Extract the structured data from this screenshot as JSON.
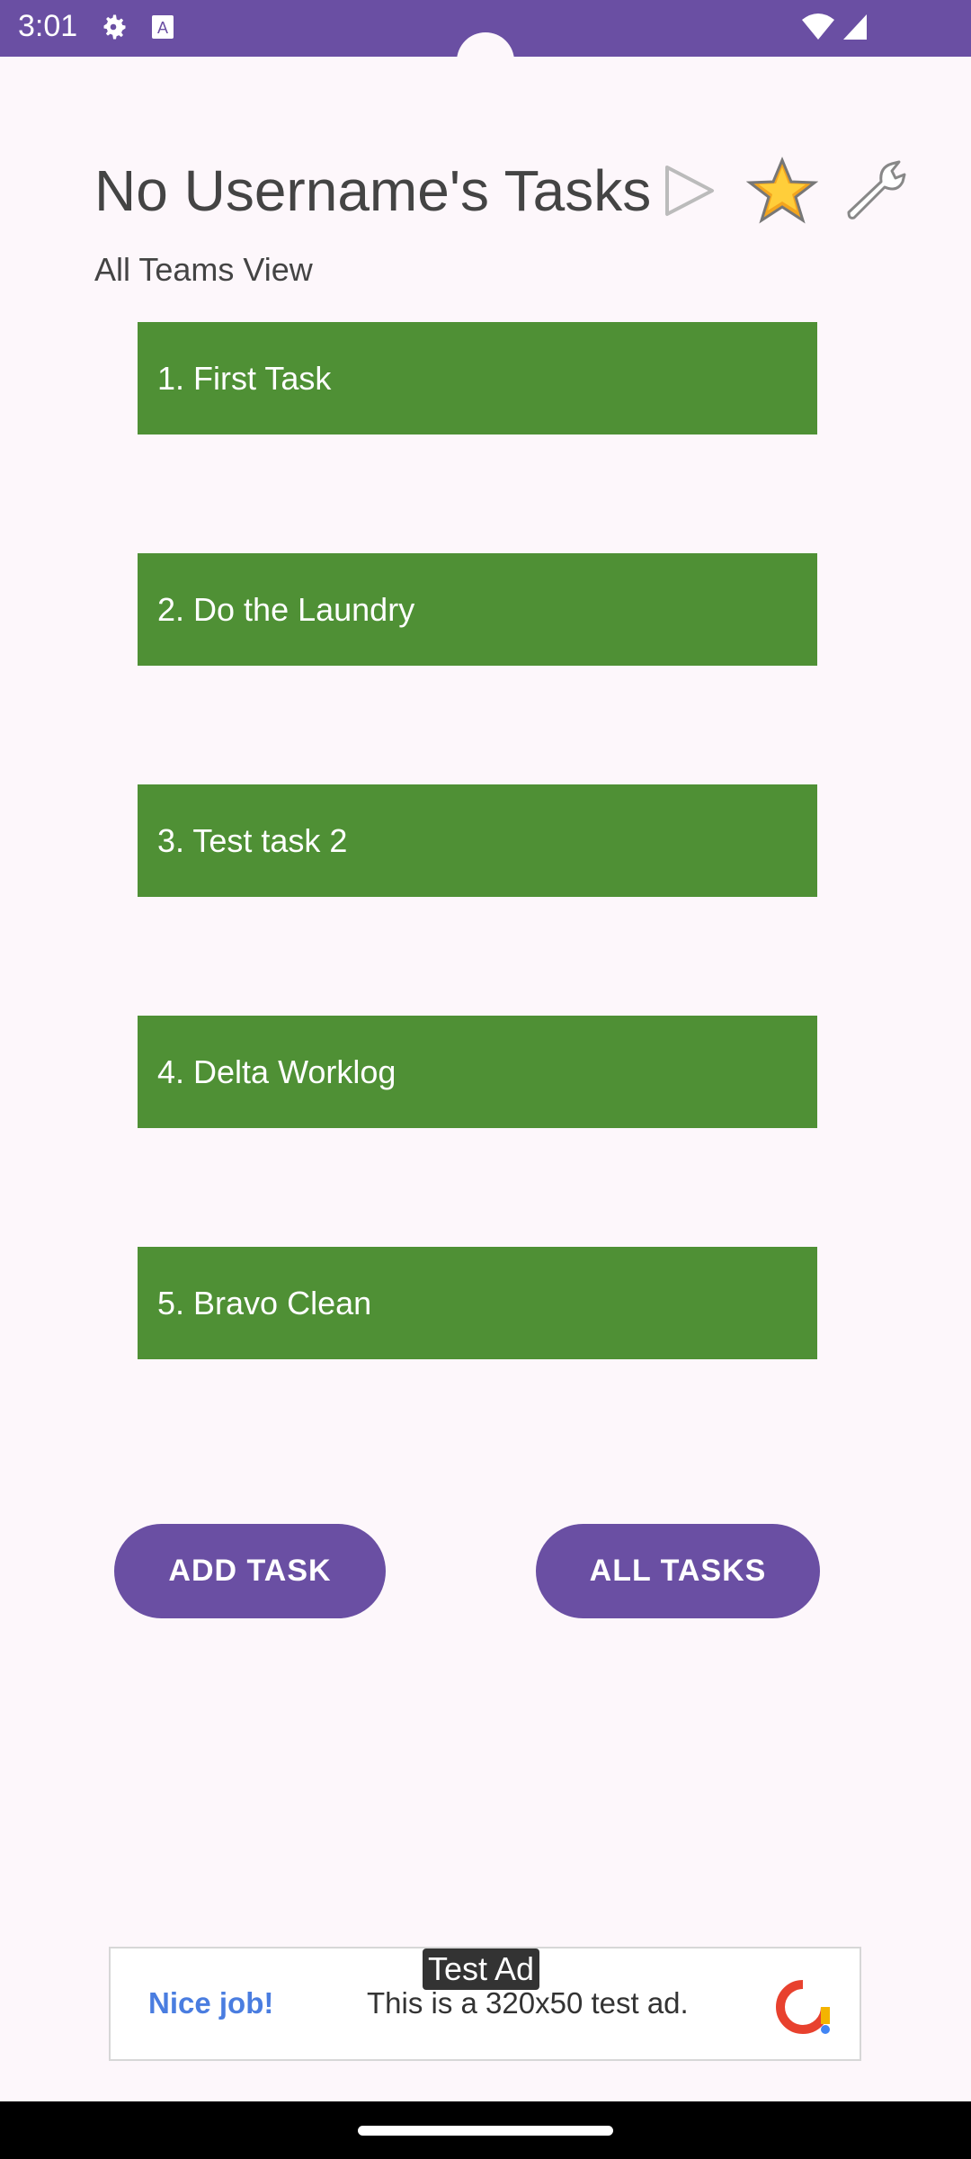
{
  "status_bar": {
    "time": "3:01",
    "icons": [
      "gear-icon",
      "a-box-icon",
      "wifi-icon",
      "signal-icon"
    ]
  },
  "header": {
    "title": "No Username's Tasks",
    "subtitle": "All Teams View",
    "tools": [
      "play-icon",
      "star-icon",
      "wrench-icon"
    ]
  },
  "tasks": [
    {
      "label": "1. First Task"
    },
    {
      "label": "2. Do the Laundry"
    },
    {
      "label": "3. Test task 2"
    },
    {
      "label": "4. Delta Worklog"
    },
    {
      "label": "5. Bravo Clean"
    }
  ],
  "buttons": {
    "add_task": "ADD TASK",
    "all_tasks": "ALL TASKS"
  },
  "ad": {
    "label": "Test Ad",
    "nice": "Nice job!",
    "text": "This is a 320x50 test ad."
  },
  "colors": {
    "accent": "#6a4fa3",
    "task_bg": "#4f9035",
    "background": "#fdf7fb"
  }
}
